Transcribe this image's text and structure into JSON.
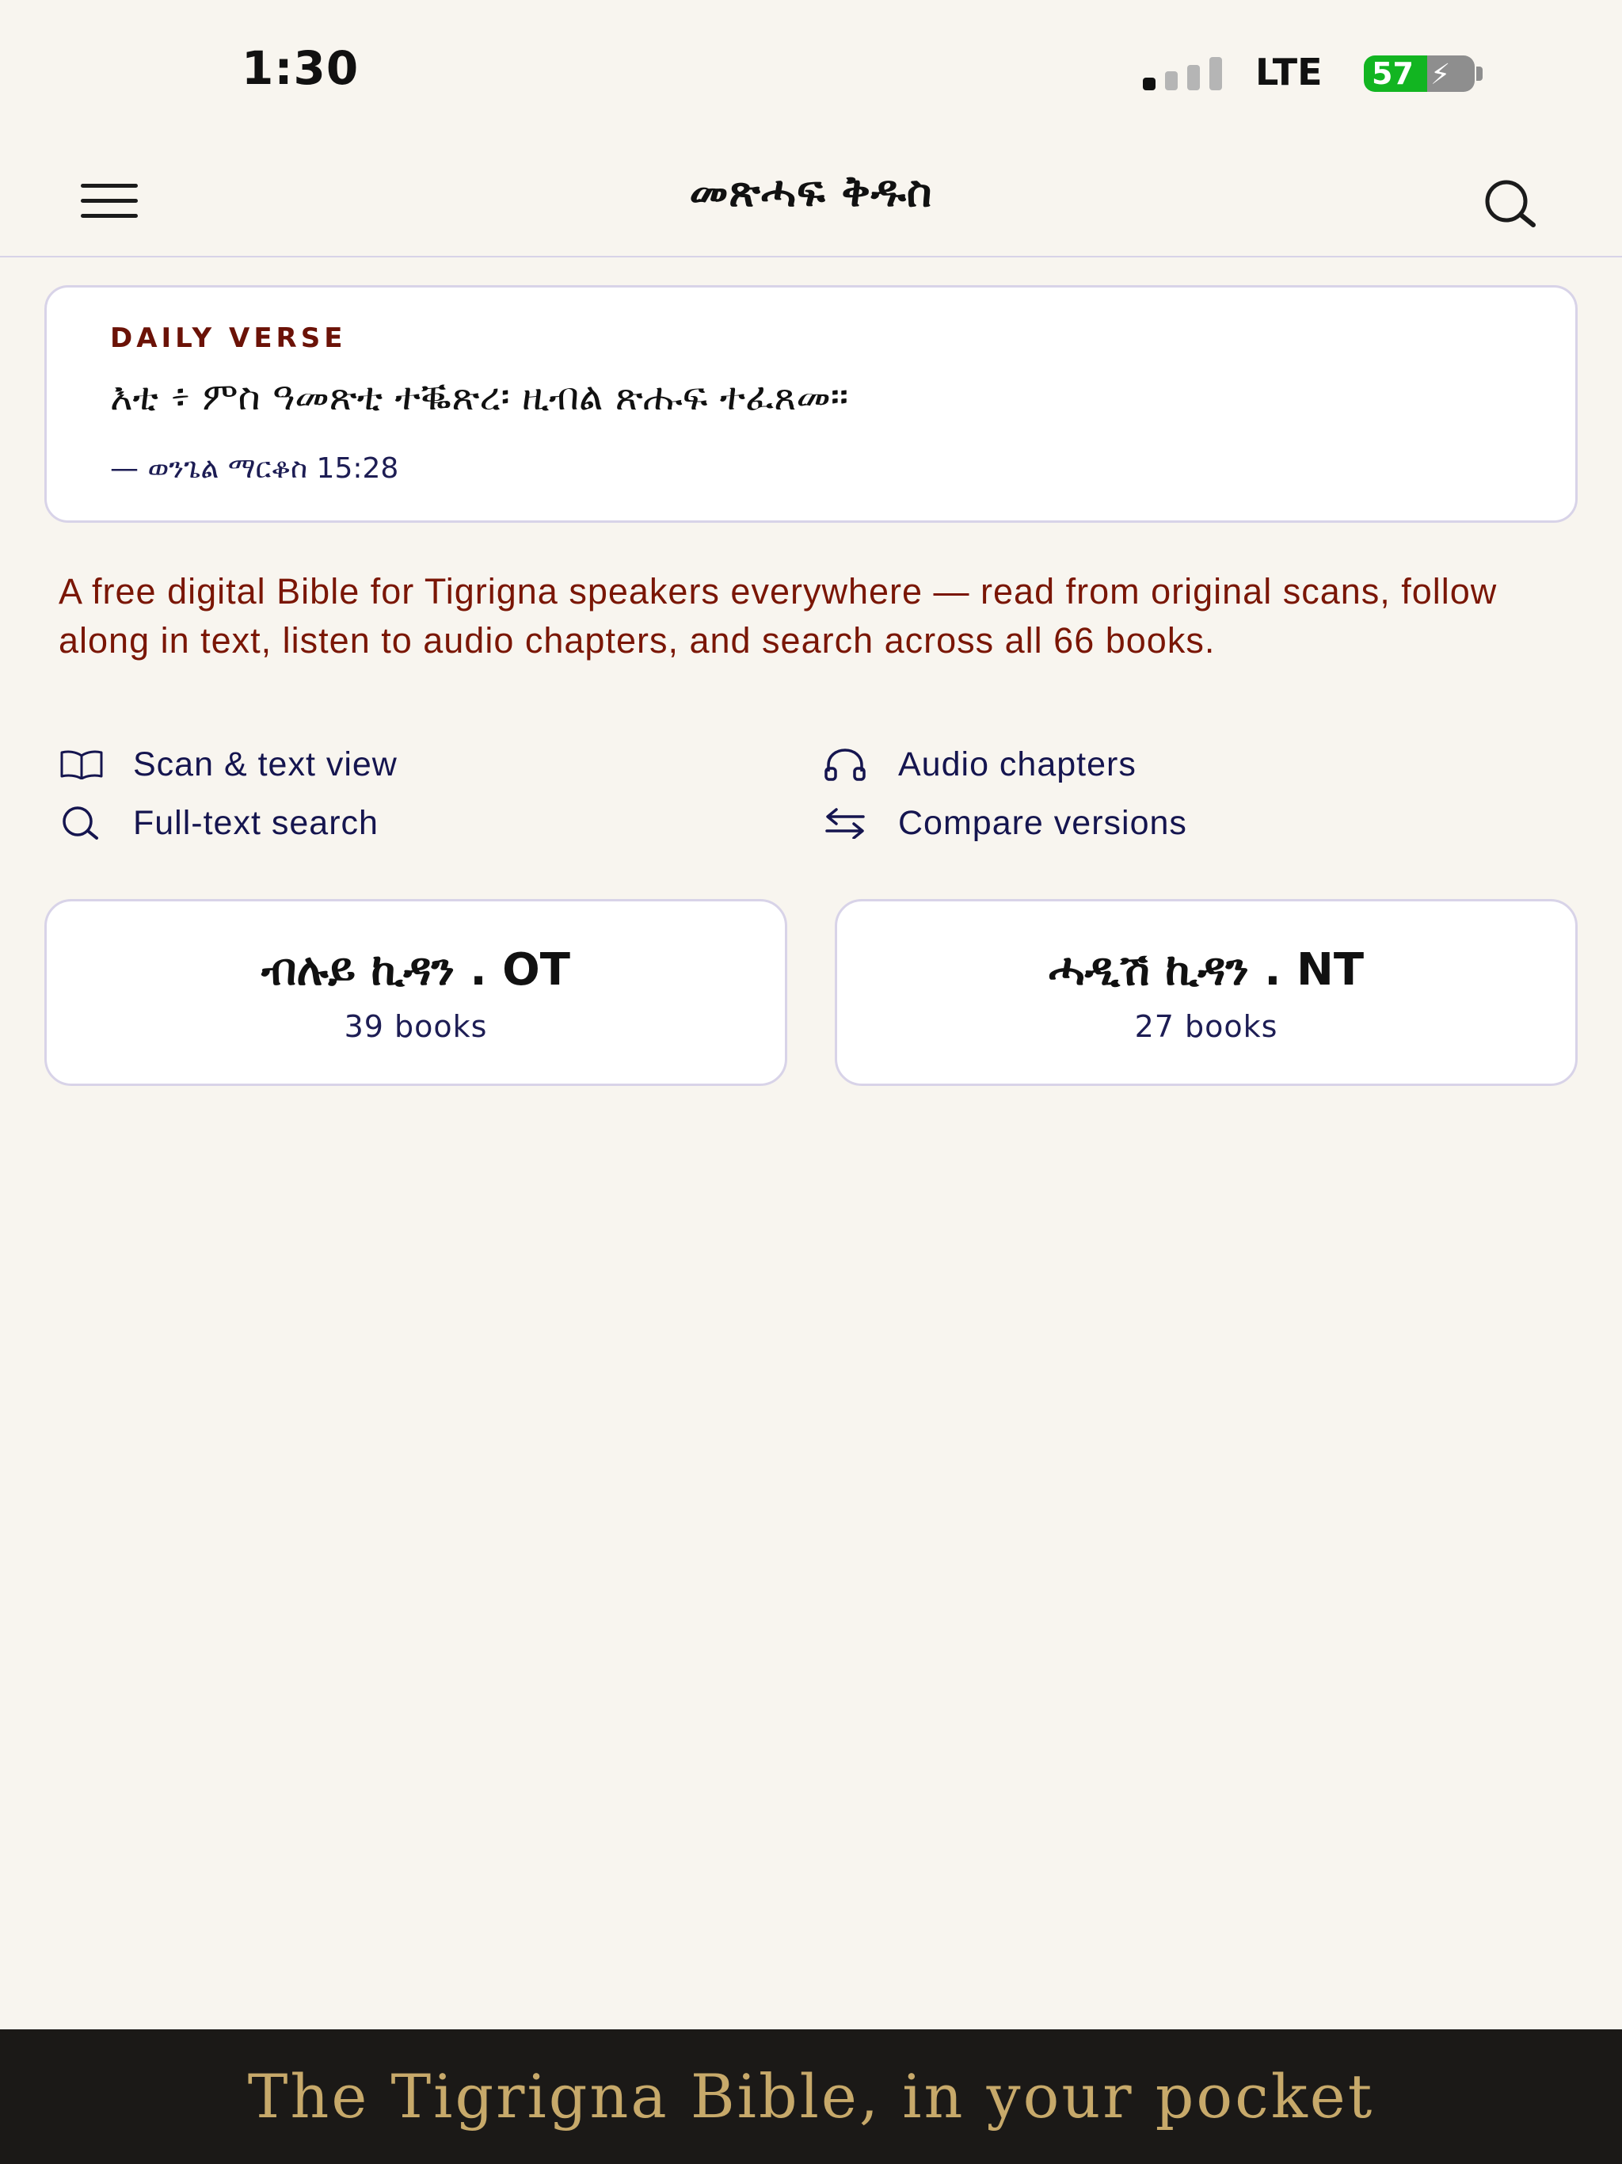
{
  "status_bar": {
    "time": "1:30",
    "network": "LTE",
    "battery": "57"
  },
  "header": {
    "title": "መጽሓፍ ቅዱስ"
  },
  "daily_verse": {
    "label": "DAILY VERSE",
    "text": "እቲ ፥ ምስ ዓመጽቲ ተቘጽረ፡ ዚብል ጽሑፍ ተፈጸመ።",
    "reference": "— ወንጌል ማርቆስ 15:28"
  },
  "intro": {
    "text": "A free digital Bible for Tigrigna speakers everywhere — read from original scans, follow along in text, listen to audio chapters, and search across all 66 books."
  },
  "features": [
    {
      "label": "Scan & text view",
      "icon": "book-icon"
    },
    {
      "label": "Audio chapters",
      "icon": "headphones-icon"
    },
    {
      "label": "Full-text search",
      "icon": "search-icon"
    },
    {
      "label": "Compare versions",
      "icon": "swap-arrows-icon"
    }
  ],
  "testaments": [
    {
      "title": "ብሉይ ኪዳን . OT",
      "count": "39 books"
    },
    {
      "title": "ሓዲሽ ኪዳን . NT",
      "count": "27 books"
    }
  ],
  "promo": {
    "text": "The Tigrigna Bible, in your pocket"
  },
  "colors": {
    "background": "#f8f5ef",
    "accent_red": "#7a1605",
    "navy": "#15154f",
    "border": "#d8d3e8",
    "gold": "#c7a96a",
    "banner": "#1b1917"
  }
}
